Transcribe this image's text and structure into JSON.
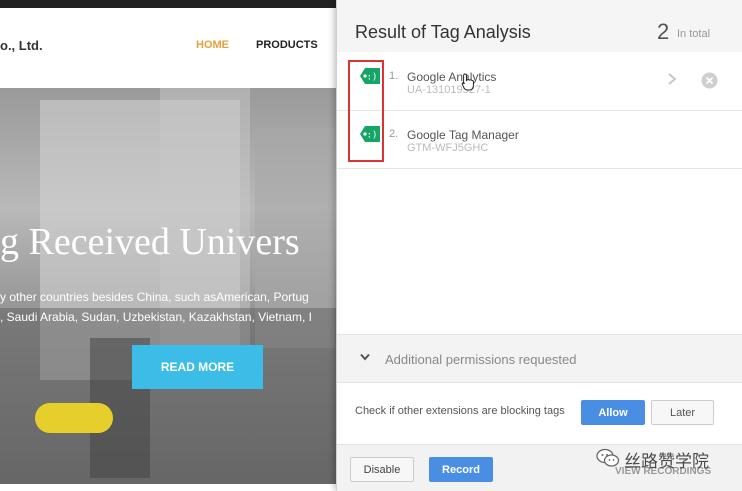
{
  "website": {
    "company_name": "o., Ltd.",
    "nav": {
      "home": "HOME",
      "products": "PRODUCTS"
    },
    "hero": {
      "title": "g Received Univers",
      "subtitle_line1": "y other countries besides China, such asAmerican, Portug",
      "subtitle_line2": ", Saudi Arabia, Sudan, Uzbekistan, Kazakhstan, Vietnam, I",
      "cta": "READ MORE"
    }
  },
  "popup": {
    "title": "Result of Tag Analysis",
    "count": "2",
    "count_label": "In total",
    "tags": [
      {
        "number": "1.",
        "name": "Google Analytics",
        "id": "UA-131019527-1",
        "icon": "tag-icon"
      },
      {
        "number": "2.",
        "name": "Google Tag Manager",
        "id": "GTM-WFJ5GHC",
        "icon": "tag-icon"
      }
    ],
    "permissions": {
      "label": "Additional permissions requested",
      "icon": "chevron-down-icon"
    },
    "blocking": {
      "text": "Check if other extensions are blocking tags",
      "allow": "Allow",
      "later": "Later"
    },
    "footer": {
      "disable": "Disable",
      "record": "Record",
      "view_recordings": "VIEW RECORDINGS"
    }
  },
  "watermark": {
    "text": "丝路赞学院"
  },
  "colors": {
    "accent_blue": "#4a8ee4",
    "tag_green": "#17a467",
    "highlight_red": "#dd3333",
    "home_nav": "#e5a13a",
    "cta_blue": "#3bbde8"
  }
}
